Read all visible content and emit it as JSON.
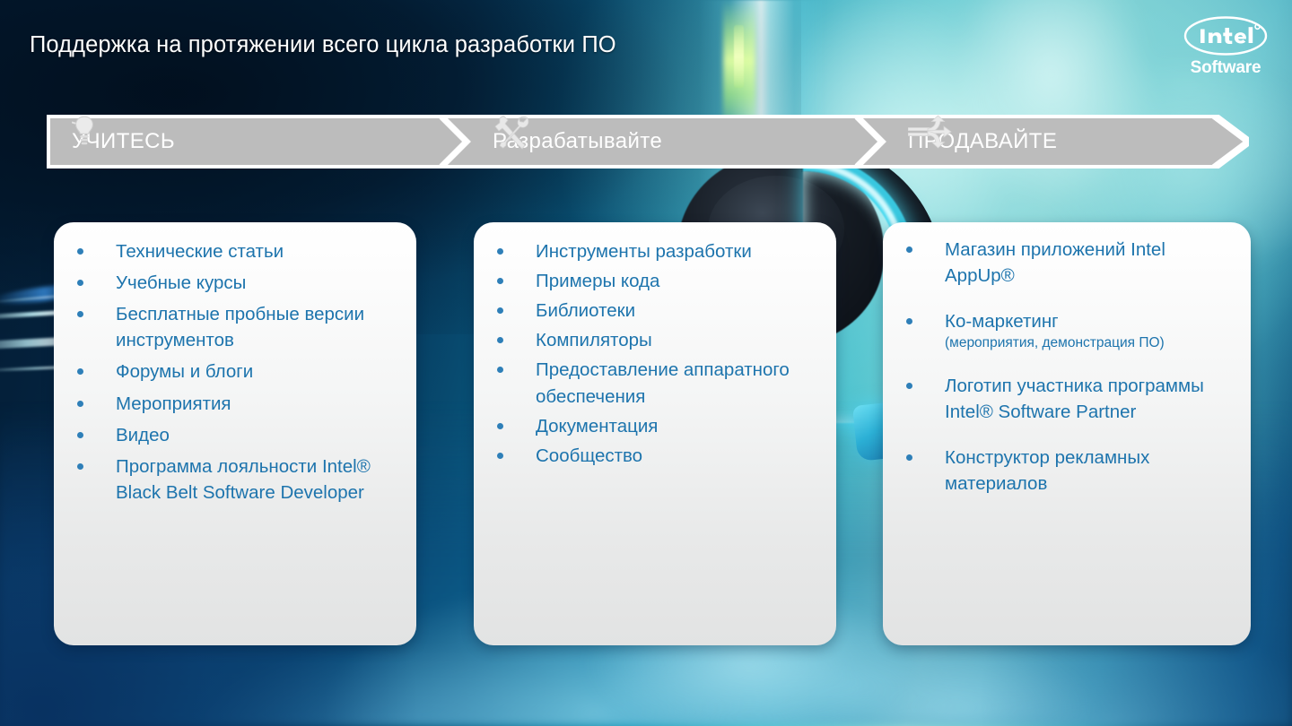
{
  "slide": {
    "title": "Поддержка на протяжении всего цикла разработки ПО"
  },
  "logo": {
    "brand": "intel",
    "sub": "Software"
  },
  "banner": {
    "stages": [
      {
        "label": "УЧИТЕСЬ",
        "icon": "lightbulb-icon"
      },
      {
        "label": "Разрабатывайте",
        "icon": "tools-icon"
      },
      {
        "label": "ПРОДАВАЙТЕ",
        "icon": "distribute-arrows-icon"
      }
    ],
    "fill_color": "#bcbcbc",
    "text_color": "#ffffff"
  },
  "cards": [
    {
      "name": "learn-card",
      "items": [
        {
          "text": "Технические статьи"
        },
        {
          "text": "Учебные курсы"
        },
        {
          "text": "Бесплатные пробные версии инструментов"
        },
        {
          "text": "Форумы и блоги"
        },
        {
          "text": "Мероприятия"
        },
        {
          "text": "Видео"
        },
        {
          "text": "Программа лояльности Intel® Black Belt Software Developer"
        }
      ]
    },
    {
      "name": "develop-card",
      "items": [
        {
          "text": "Инструменты разработки"
        },
        {
          "text": "Примеры кода"
        },
        {
          "text": "Библиотеки"
        },
        {
          "text": "Компиляторы"
        },
        {
          "text": "Предоставление аппаратного обеспечения"
        },
        {
          "text": "Документация"
        },
        {
          "text": "Сообщество"
        }
      ]
    },
    {
      "name": "sell-card",
      "items": [
        {
          "text": "Магазин приложений Intel AppUp®"
        },
        {
          "text": "Ко-маркетинг",
          "note": "(мероприятия, демонстрация ПО)"
        },
        {
          "text": "Логотип участника программы Intel® Software Partner"
        },
        {
          "text": "Конструктор рекламных материалов"
        }
      ]
    }
  ],
  "colors": {
    "bullet_text": "#1d74ad",
    "bullet_dot": "#2e7fb8",
    "card_bg": "#f2f3f3",
    "banner_fill": "#bcbcbc",
    "title_text": "#ffffff",
    "bg_dark": "#031b33",
    "bg_cyan": "#49c3cf"
  }
}
